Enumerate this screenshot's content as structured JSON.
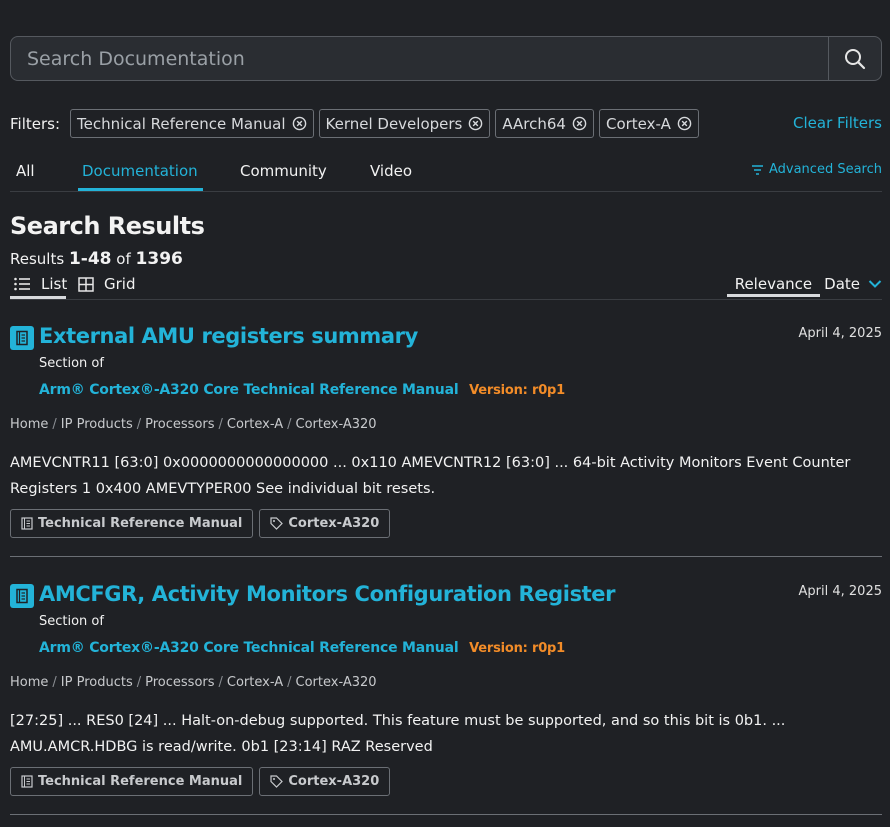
{
  "search": {
    "placeholder": "Search Documentation",
    "value": ""
  },
  "filters": {
    "label": "Filters:",
    "chips": [
      "Technical Reference Manual",
      "Kernel Developers",
      "AArch64",
      "Cortex-A"
    ],
    "clear_label": "Clear Filters"
  },
  "tabs": [
    {
      "label": "All",
      "active": false
    },
    {
      "label": "Documentation",
      "active": true
    },
    {
      "label": "Community",
      "active": false
    },
    {
      "label": "Video",
      "active": false
    }
  ],
  "advanced_search_label": "Advanced Search",
  "results_header": {
    "title": "Search Results",
    "prefix": "Results",
    "range": "1-48",
    "of": "of",
    "total": "1396"
  },
  "views": {
    "list_label": "List",
    "grid_label": "Grid",
    "active": "List"
  },
  "sort": {
    "relevance_label": "Relevance",
    "date_label": "Date",
    "active": "Relevance"
  },
  "colors": {
    "accent": "#23b3d8",
    "version": "#f28c28",
    "background": "#1f2125"
  },
  "results": [
    {
      "title": "External AMU registers summary",
      "date": "April 4, 2025",
      "section_label": "Section of",
      "manual": "Arm® Cortex®-A320 Core Technical Reference Manual",
      "version": "Version: r0p1",
      "breadcrumb": [
        "Home",
        "IP Products",
        "Processors",
        "Cortex-A",
        "Cortex-A320"
      ],
      "description": "AMEVCNTR11 [63:0] 0x0000000000000000 ... 0x110 AMEVCNTR12 [63:0] ... 64-bit Activity Monitors Event Counter Registers 1 0x400 AMEVTYPER00 See individual bit resets.",
      "tags": [
        "Technical Reference Manual",
        "Cortex-A320"
      ]
    },
    {
      "title": "AMCFGR, Activity Monitors Configuration Register",
      "date": "April 4, 2025",
      "section_label": "Section of",
      "manual": "Arm® Cortex®-A320 Core Technical Reference Manual",
      "version": "Version: r0p1",
      "breadcrumb": [
        "Home",
        "IP Products",
        "Processors",
        "Cortex-A",
        "Cortex-A320"
      ],
      "description": "[27:25] ... RES0 [24] ... Halt-on-debug supported. This feature must be supported, and so this bit is 0b1. ... AMU.AMCR.HDBG is read/write. 0b1 [23:14] RAZ Reserved",
      "tags": [
        "Technical Reference Manual",
        "Cortex-A320"
      ]
    }
  ]
}
